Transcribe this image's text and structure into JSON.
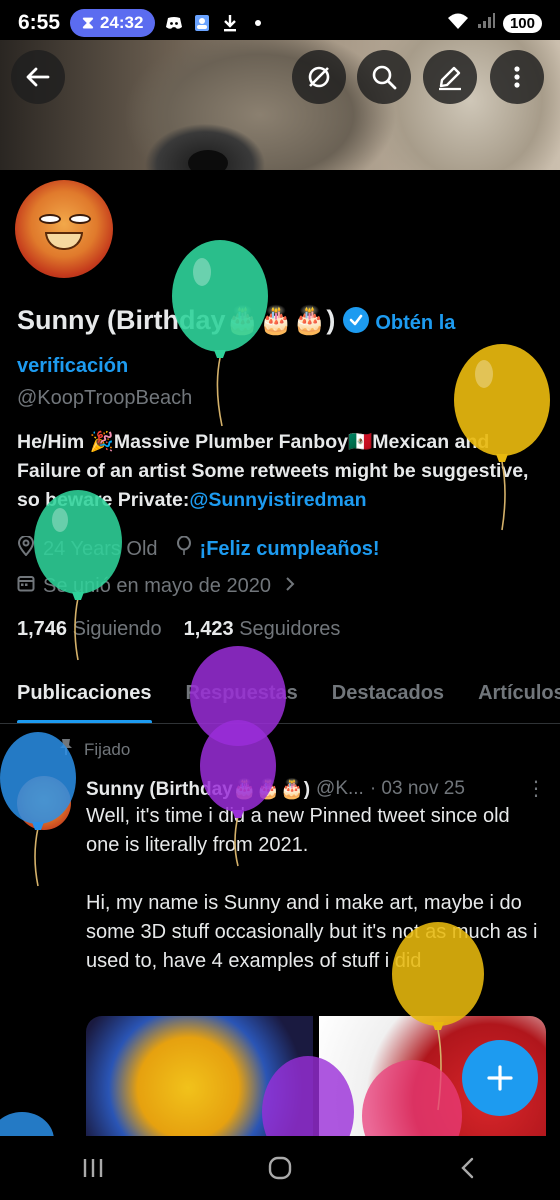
{
  "status_bar": {
    "time": "6:55",
    "timer": "24:32",
    "battery": "100"
  },
  "profile": {
    "name": "Sunny (Birthday🎂🎂🎂)",
    "verification_link": "Obtén la verificación",
    "handle": "@KoopTroopBeach",
    "bio_text": "He/Him 🎉Massive Plumber Fanboy🇲🇽Mexican and Failure of an artist Some retweets might be suggestive, so beware Private:",
    "bio_mention": "@Sunnyistiredman",
    "age": "24 Years Old",
    "birthday_link": "¡Feliz cumpleaños!",
    "joined": "Se unió en mayo de 2020",
    "following_count": "1,746",
    "following_label": "Siguiendo",
    "followers_count": "1,423",
    "followers_label": "Seguidores"
  },
  "tabs": [
    {
      "label": "Publicaciones",
      "active": true
    },
    {
      "label": "Respuestas",
      "active": false
    },
    {
      "label": "Destacados",
      "active": false
    },
    {
      "label": "Artículos",
      "active": false
    }
  ],
  "tweet": {
    "pinned_label": "Fijado",
    "author_name": "Sunny (Birthday🎂🎂🎂)",
    "author_handle": "@K...",
    "date": "· 03 nov 25",
    "text": "Well, it's time i did a new Pinned tweet since old one is literally from 2021.\n\nHi, my name is Sunny and i make art, maybe i do some 3D stuff occasionally but it's not as much as i used to, have 4 examples of stuff i did"
  },
  "colors": {
    "accent": "#1d9bf0",
    "background": "#000000",
    "muted_text": "#71767b",
    "primary_text": "#e7e9ea"
  },
  "icons": {
    "back": "arrow-left-icon",
    "grok": "circle-slash-icon",
    "search": "search-icon",
    "edit": "pencil-icon",
    "more": "more-vertical-icon",
    "verified": "verified-badge-icon",
    "location": "location-pin-icon",
    "birthday": "balloon-icon",
    "calendar": "calendar-icon",
    "compose": "plus-icon"
  }
}
